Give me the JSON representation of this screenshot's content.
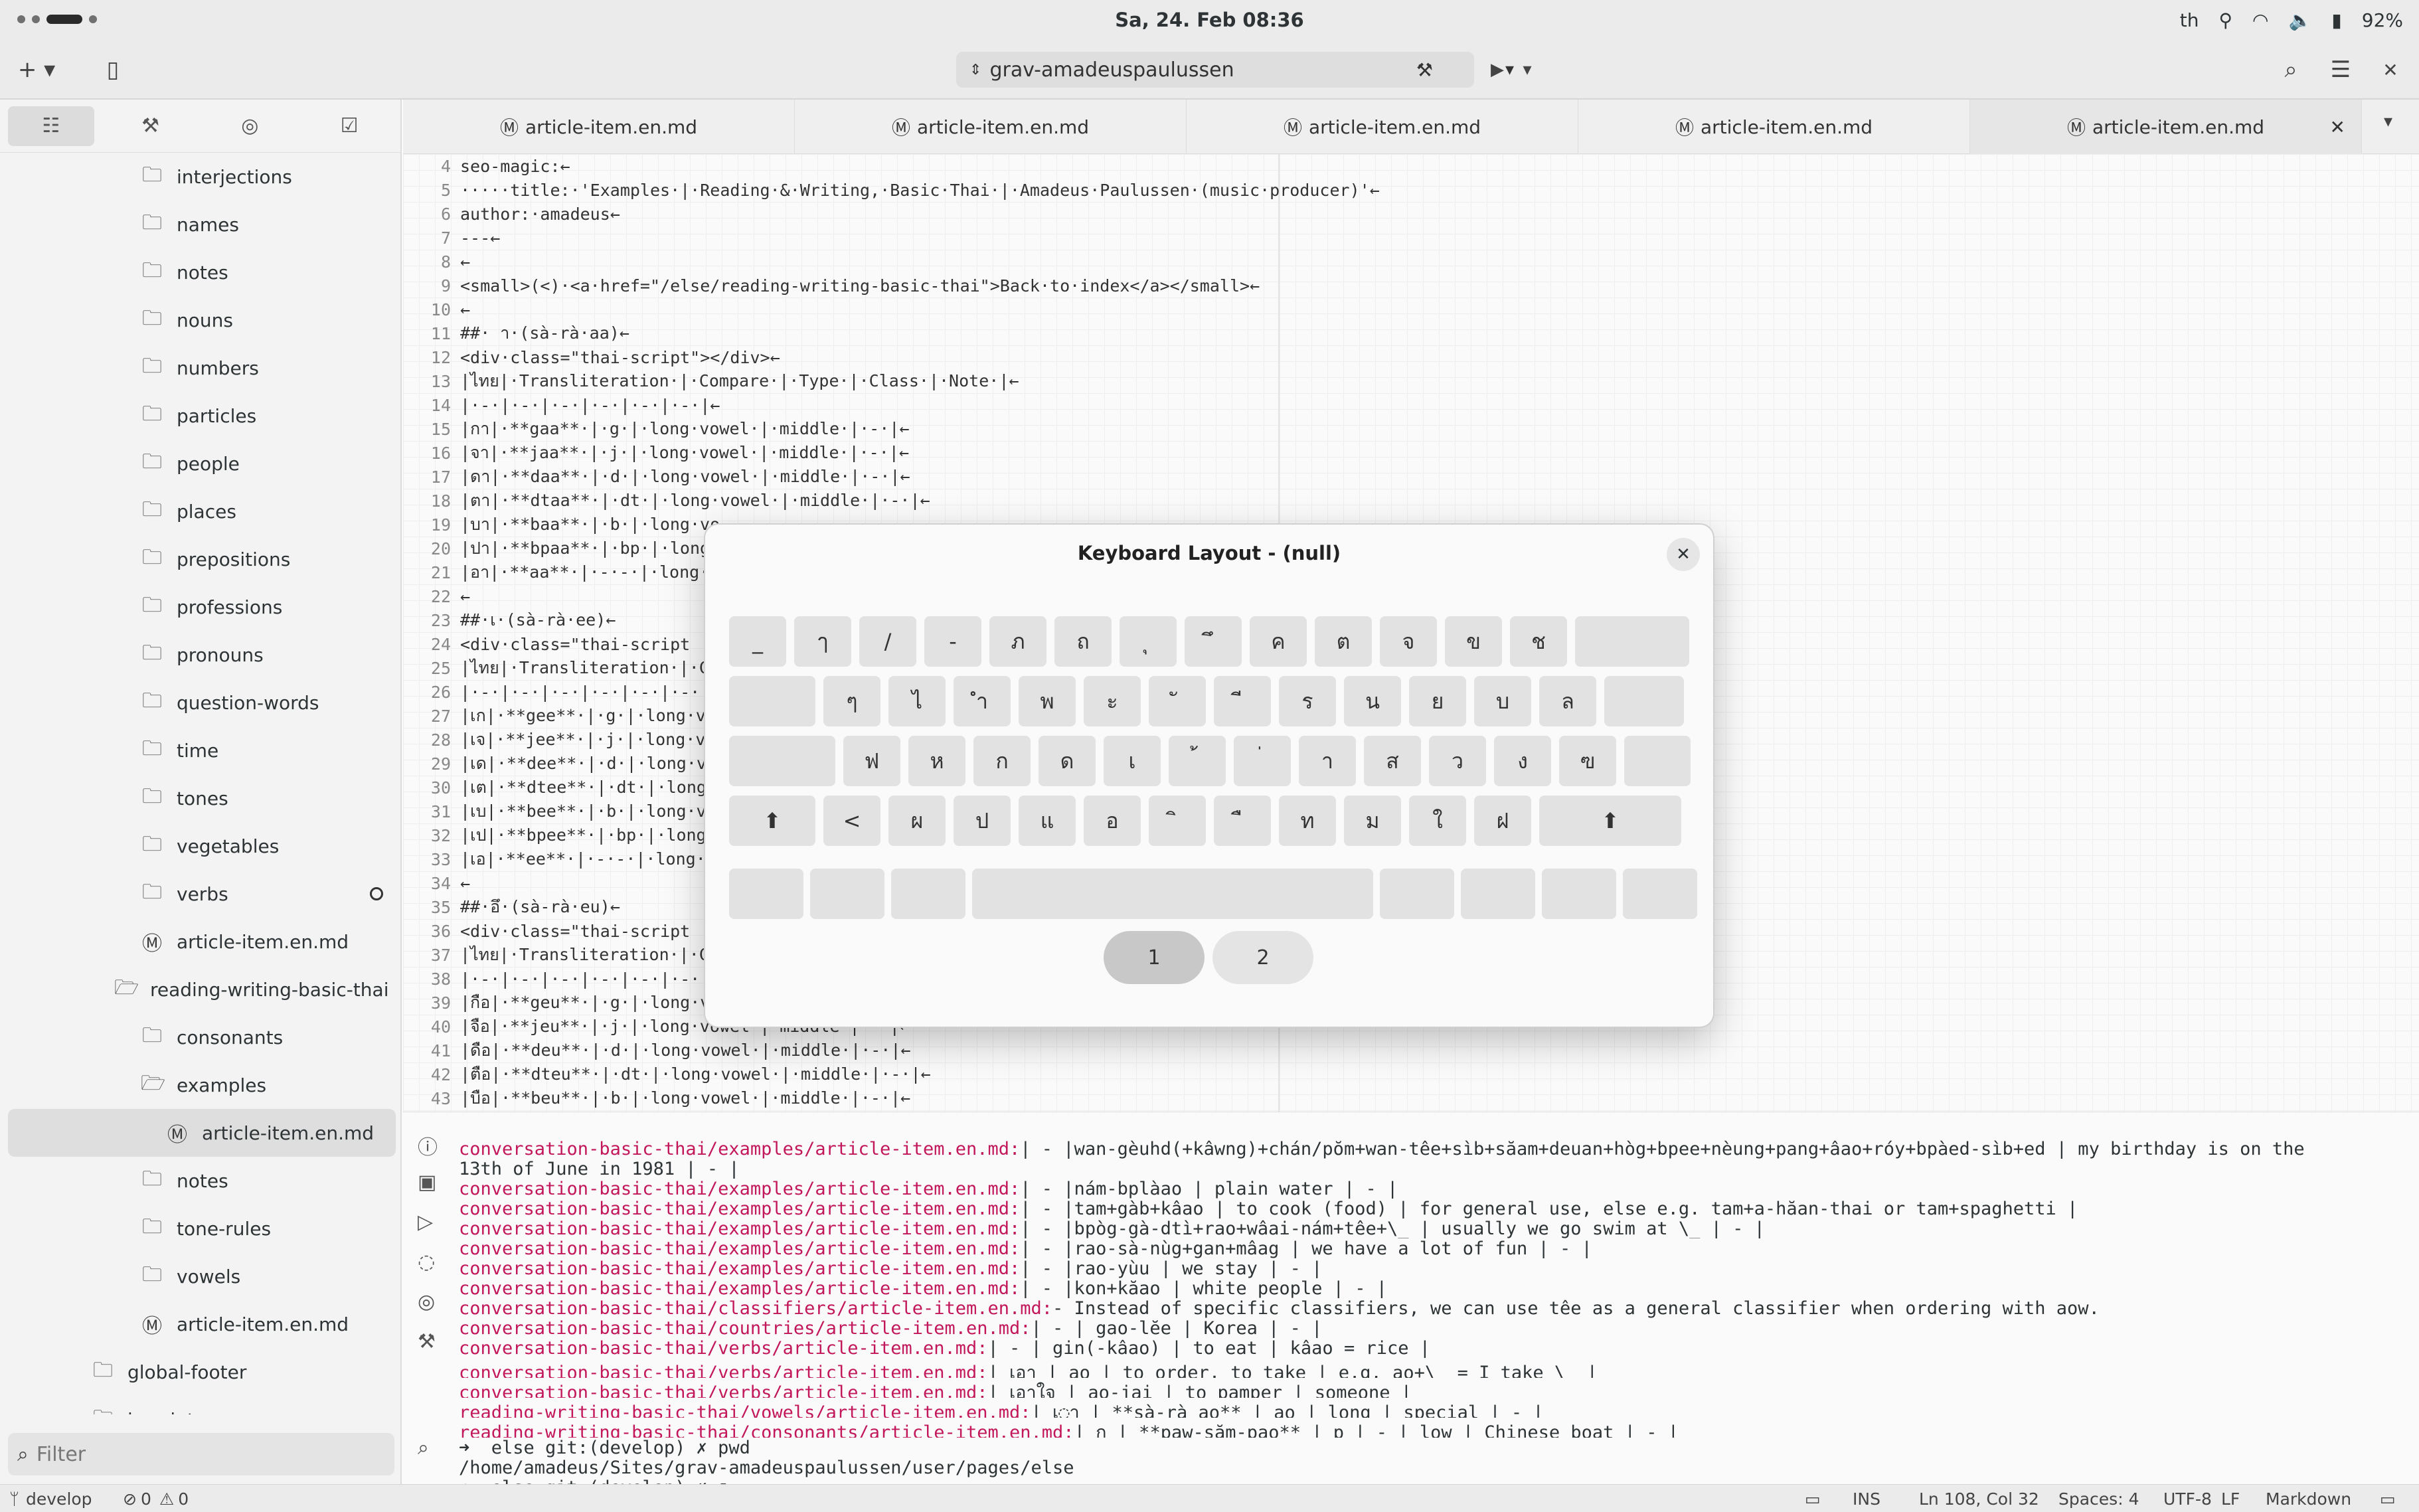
{
  "system": {
    "clock": "Sa, 24. Feb  08:36",
    "lang": "th",
    "battery": "92%"
  },
  "header": {
    "title": "grav-amadeuspaulussen"
  },
  "sidebar": {
    "items": [
      {
        "label": "interjections",
        "icon": "folder",
        "depth": 2
      },
      {
        "label": "names",
        "icon": "folder",
        "depth": 2
      },
      {
        "label": "notes",
        "icon": "folder",
        "depth": 2
      },
      {
        "label": "nouns",
        "icon": "folder",
        "depth": 2
      },
      {
        "label": "numbers",
        "icon": "folder",
        "depth": 2
      },
      {
        "label": "particles",
        "icon": "folder",
        "depth": 2
      },
      {
        "label": "people",
        "icon": "folder",
        "depth": 2
      },
      {
        "label": "places",
        "icon": "folder",
        "depth": 2
      },
      {
        "label": "prepositions",
        "icon": "folder",
        "depth": 2
      },
      {
        "label": "professions",
        "icon": "folder",
        "depth": 2
      },
      {
        "label": "pronouns",
        "icon": "folder",
        "depth": 2
      },
      {
        "label": "question-words",
        "icon": "folder",
        "depth": 2
      },
      {
        "label": "time",
        "icon": "folder",
        "depth": 2
      },
      {
        "label": "tones",
        "icon": "folder",
        "depth": 2
      },
      {
        "label": "vegetables",
        "icon": "folder",
        "depth": 2
      },
      {
        "label": "verbs",
        "icon": "folder",
        "depth": 2,
        "modified": true
      },
      {
        "label": "article-item.en.md",
        "icon": "markdown",
        "depth": 2
      },
      {
        "label": "reading-writing-basic-thai",
        "icon": "folder-open",
        "depth": 1
      },
      {
        "label": "consonants",
        "icon": "folder",
        "depth": 2
      },
      {
        "label": "examples",
        "icon": "folder-open",
        "depth": 2
      },
      {
        "label": "article-item.en.md",
        "icon": "markdown",
        "depth": 3,
        "selected": true
      },
      {
        "label": "notes",
        "icon": "folder",
        "depth": 2
      },
      {
        "label": "tone-rules",
        "icon": "folder",
        "depth": 2
      },
      {
        "label": "vowels",
        "icon": "folder",
        "depth": 2
      },
      {
        "label": "article-item.en.md",
        "icon": "markdown",
        "depth": 2
      },
      {
        "label": "global-footer",
        "icon": "folder",
        "depth": 0
      },
      {
        "label": "imprint",
        "icon": "folder",
        "depth": 0
      }
    ],
    "filter_placeholder": "Filter"
  },
  "tabs": [
    {
      "label": "article-item.en.md"
    },
    {
      "label": "article-item.en.md"
    },
    {
      "label": "article-item.en.md"
    },
    {
      "label": "article-item.en.md"
    },
    {
      "label": "article-item.en.md",
      "active": true
    }
  ],
  "editor": {
    "lines": [
      {
        "n": "4",
        "t": "seo-magic:←"
      },
      {
        "n": "5",
        "t": "·····title:·'Examples·|·Reading·&·Writing,·Basic·Thai·|·Amadeus·Paulussen·(music·producer)'←"
      },
      {
        "n": "6",
        "t": "author:·amadeus←"
      },
      {
        "n": "7",
        "t": "---←"
      },
      {
        "n": "8",
        "t": "←"
      },
      {
        "n": "9",
        "t": "<small>(<)·<a·href=\"/else/reading-writing-basic-thai\">Back·to·index</a></small>←"
      },
      {
        "n": "10",
        "t": "←"
      },
      {
        "n": "11",
        "t": "##· า·(sà-rà·aa)←"
      },
      {
        "n": "12",
        "t": "<div·class=\"thai-script\"></div>←"
      },
      {
        "n": "13",
        "t": "|ไทย|·Transliteration·|·Compare·|·Type·|·Class·|·Note·|←"
      },
      {
        "n": "14",
        "t": "|·-·|·-·|·-·|·-·|·-·|·-·|←"
      },
      {
        "n": "15",
        "t": "|กา|·**gaa**·|·g·|·long·vowel·|·middle·|·-·|←"
      },
      {
        "n": "16",
        "t": "|จา|·**jaa**·|·j·|·long·vowel·|·middle·|·-·|←"
      },
      {
        "n": "17",
        "t": "|ดา|·**daa**·|·d·|·long·vowel·|·middle·|·-·|←"
      },
      {
        "n": "18",
        "t": "|ตา|·**dtaa**·|·dt·|·long·vowel·|·middle·|·-·|←"
      },
      {
        "n": "19",
        "t": "|บา|·**baa**·|·b·|·long·vo"
      },
      {
        "n": "20",
        "t": "|ปา|·**bpaa**·|·bp·|·long"
      },
      {
        "n": "21",
        "t": "|อา|·**aa**·|·-·-·|·long·vo"
      },
      {
        "n": "22",
        "t": "←"
      },
      {
        "n": "23",
        "t": "##·เ·(sà-rà·ee)←"
      },
      {
        "n": "24",
        "t": "<div·class=\"thai-script"
      },
      {
        "n": "25",
        "t": "|ไทย|·Transliteration·|·C"
      },
      {
        "n": "26",
        "t": "|·-·|·-·|·-·|·-·|·-·|·-·|"
      },
      {
        "n": "27",
        "t": "|เก|·**gee**·|·g·|·long·vo"
      },
      {
        "n": "28",
        "t": "|เจ|·**jee**·|·j·|·long·vo"
      },
      {
        "n": "29",
        "t": "|เด|·**dee**·|·d·|·long·vo"
      },
      {
        "n": "30",
        "t": "|เต|·**dtee**·|·dt·|·long"
      },
      {
        "n": "31",
        "t": "|เบ|·**bee**·|·b·|·long·vo"
      },
      {
        "n": "32",
        "t": "|เป|·**bpee**·|·bp·|·long"
      },
      {
        "n": "33",
        "t": "|เอ|·**ee**·|·-·-·|·long·vow"
      },
      {
        "n": "34",
        "t": "←"
      },
      {
        "n": "35",
        "t": "##·อึ·(sà-rà·eu)←"
      },
      {
        "n": "36",
        "t": "<div·class=\"thai-script"
      },
      {
        "n": "37",
        "t": "|ไทย|·Transliteration·|·C"
      },
      {
        "n": "38",
        "t": "|·-·|·-·|·-·|·-·|·-·|·-·|"
      },
      {
        "n": "39",
        "t": "|กือ|·**geu**·|·g·|·long·v"
      },
      {
        "n": "40",
        "t": "|จือ|·**jeu**·|·j·|·long·vowel·|·middle·|·-·|←"
      },
      {
        "n": "41",
        "t": "|ดือ|·**deu**·|·d·|·long·vowel·|·middle·|·-·|←"
      },
      {
        "n": "42",
        "t": "|ตือ|·**dteu**·|·dt·|·long·vowel·|·middle·|·-·|←"
      },
      {
        "n": "43",
        "t": "|บือ|·**beu**·|·b·|·long·vowel·|·middle·|·-·|←"
      }
    ]
  },
  "terminal": {
    "lines": [
      {
        "p": "conversation-basic-thai/examples/article-item.en.md:",
        "t": "| - |wan-gèuhd(+kâwng)+chán/pŏm+wan-têe+sìb+săam+deuan+hòg+bpee+nèung+pang+âao+róy+bpàed-sìb+ed | my birthday is on the"
      },
      {
        "p": "",
        "t": "13th of June in 1981 | - |"
      },
      {
        "p": "conversation-basic-thai/examples/article-item.en.md:",
        "t": "| - |nám-bplàao | plain water | - |"
      },
      {
        "p": "conversation-basic-thai/examples/article-item.en.md:",
        "t": "| - |tam+gàb+kâao | to cook (food) | for general use, else e.g. tam+a-hăan-thai or tam+spaghetti |"
      },
      {
        "p": "conversation-basic-thai/examples/article-item.en.md:",
        "t": "| - |bpòg-gà-dtì+rao+wâai-nám+têe+\\_ | usually we go swim at \\_ | - |"
      },
      {
        "p": "conversation-basic-thai/examples/article-item.en.md:",
        "t": "| - |rao-sà-nùg+gan+mâag | we have a lot of fun | - |"
      },
      {
        "p": "conversation-basic-thai/examples/article-item.en.md:",
        "t": "| - |rao-yùu | we stay | - |"
      },
      {
        "p": "conversation-basic-thai/examples/article-item.en.md:",
        "t": "| - |kon+kăao | white people | - |"
      },
      {
        "p": "conversation-basic-thai/classifiers/article-item.en.md:",
        "t": "- Instead of specific classifiers, we can use têe as a general classifier when ordering with aow."
      },
      {
        "p": "conversation-basic-thai/countries/article-item.en.md:",
        "t": "| - | gao-lĕe | Korea | - |"
      },
      {
        "p": "conversation-basic-thai/verbs/article-item.en.md:",
        "t": "| - | gin(-kâao) | to eat | kâao = rice |"
      },
      {
        "p": "conversation-basic-thai/verbs/article-item.en.md:",
        "t": "| เอา | ao | to order, to take | e.g. ao+\\_ = I take \\_ |"
      },
      {
        "p": "conversation-basic-thai/verbs/article-item.en.md:",
        "t": "| เอาใจ | ao-jai | to pamper | someone |"
      },
      {
        "p": "reading-writing-basic-thai/vowels/article-item.en.md:",
        "t": "| เ◌า | **sà-rà ao** | ao | long | special | - |"
      },
      {
        "p": "reading-writing-basic-thai/consonants/article-item.en.md:",
        "t": "| ก | **paw-săm-pao** | p | - | low | Chinese boat | - |"
      },
      {
        "p": "",
        "t": "➜  else git:(develop) ✗ pwd"
      },
      {
        "p": "",
        "t": "/home/amadeus/Sites/grav-amadeuspaulussen/user/pages/else"
      },
      {
        "p": "",
        "t": "➜  else git:(develop) ✗ ▯"
      }
    ]
  },
  "dialog": {
    "title": "Keyboard Layout - (null)",
    "rows": [
      [
        "_",
        "ๅ",
        "/",
        "-",
        "ภ",
        "ถ",
        "ุ",
        "ึ",
        "ค",
        "ต",
        "จ",
        "ข",
        "ช",
        ""
      ],
      [
        "",
        "ๆ",
        "ไ",
        "ำ",
        "พ",
        "ะ",
        "ั",
        "ี",
        "ร",
        "น",
        "ย",
        "บ",
        "ล",
        ""
      ],
      [
        "",
        "ฟ",
        "ห",
        "ก",
        "ด",
        "เ",
        "้",
        "่",
        "า",
        "ส",
        "ว",
        "ง",
        "ฃ",
        ""
      ],
      [
        "⬆",
        "<",
        "ผ",
        "ป",
        "แ",
        "อ",
        "ิ",
        "ื",
        "ท",
        "ม",
        "ใ",
        "ฝ",
        "⬆"
      ],
      [
        "",
        "",
        "",
        "",
        "",
        "",
        "",
        ""
      ]
    ],
    "pages": [
      "1",
      "2"
    ]
  },
  "status": {
    "branch": "develop",
    "errors": "0",
    "warnings": "0",
    "mode": "INS",
    "position": "Ln 108, Col 32",
    "spaces": "Spaces: 4",
    "encoding": "UTF-8",
    "eol": "LF",
    "language": "Markdown"
  }
}
